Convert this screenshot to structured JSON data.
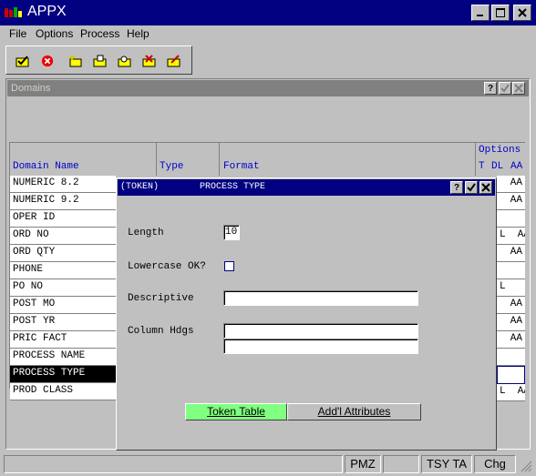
{
  "app": {
    "title": "APPX"
  },
  "menu": [
    "File",
    "Options",
    "Process",
    "Help"
  ],
  "toolbar_icons": [
    "checkmark-folder-icon",
    "cancel-icon",
    "new-item-icon",
    "folder-open-icon",
    "folder-search-icon",
    "folder-delete-icon",
    "folder-edit-icon"
  ],
  "domains_window": {
    "title": "Domains"
  },
  "grid": {
    "options_label": "Options",
    "columns": {
      "name": "Domain Name",
      "type": "Type",
      "format": "Format",
      "t": "T",
      "dl": "DL",
      "aa": "AA"
    },
    "rows": [
      {
        "name": "NUMERIC 8.2",
        "opts": "AA"
      },
      {
        "name": "NUMERIC 9.2",
        "opts": "AA"
      },
      {
        "name": "OPER ID",
        "opts": ""
      },
      {
        "name": "ORD NO",
        "opts": "L  AA"
      },
      {
        "name": "ORD QTY",
        "opts": "AA"
      },
      {
        "name": "PHONE",
        "opts": ""
      },
      {
        "name": "PO NO",
        "opts": "L"
      },
      {
        "name": "POST MO",
        "opts": "AA"
      },
      {
        "name": "POST YR",
        "opts": "AA"
      },
      {
        "name": "PRIC FACT",
        "opts": "AA"
      },
      {
        "name": "PROCESS NAME",
        "opts": ""
      },
      {
        "name": "PROCESS TYPE",
        "opts": ""
      },
      {
        "name": "PROD CLASS",
        "opts": "L  AA"
      }
    ]
  },
  "dialog": {
    "token_label": "(TOKEN)",
    "title": "PROCESS TYPE",
    "length_label": "Length",
    "length_value": "10",
    "lowercase_label": "Lowercase OK?",
    "descriptive_label": "Descriptive",
    "descriptive_value": "",
    "column_hdgs_label": "Column Hdgs",
    "column_hdg1_value": "",
    "column_hdg2_value": "",
    "token_table_button": "Token Table",
    "addl_attributes_button": "Add'l Attributes"
  },
  "status": {
    "cell1": "PMZ",
    "cell2": "",
    "cell3": "TSY TA",
    "cell4": "Chg"
  }
}
